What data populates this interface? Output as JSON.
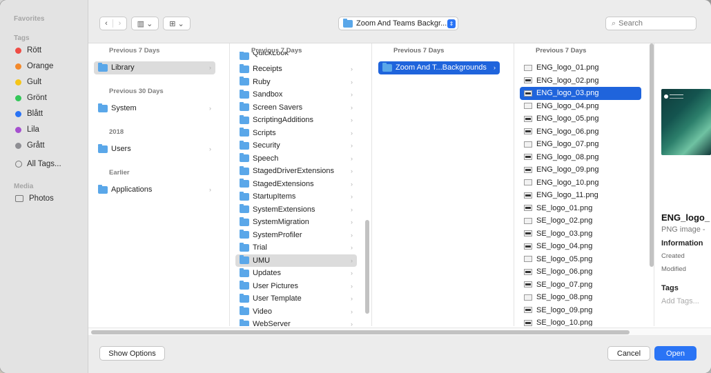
{
  "sidebar": {
    "favorites_header": "Favorites",
    "tags_header": "Tags",
    "tags": [
      {
        "label": "Rött",
        "color": "#ef4c45"
      },
      {
        "label": "Orange",
        "color": "#f3892b"
      },
      {
        "label": "Gult",
        "color": "#f5c518"
      },
      {
        "label": "Grönt",
        "color": "#34c759"
      },
      {
        "label": "Blått",
        "color": "#2a74f5"
      },
      {
        "label": "Lila",
        "color": "#a550cf"
      },
      {
        "label": "Grått",
        "color": "#8e8e93"
      }
    ],
    "all_tags": "All Tags...",
    "media_header": "Media",
    "photos": "Photos"
  },
  "toolbar": {
    "back": "‹",
    "forward": "›",
    "view_columns": "▥ ⌄",
    "group": "⊞ ⌄",
    "path": "Zoom And Teams Backgr...",
    "path_chevron": "⇕",
    "search_placeholder": "Search"
  },
  "column1": {
    "groups": [
      {
        "header": "Previous 7 Days",
        "item": "Library"
      },
      {
        "header": "Previous 30 Days",
        "item": "System"
      },
      {
        "header": "2018",
        "item": "Users"
      },
      {
        "header": "Earlier",
        "item": "Applications"
      }
    ]
  },
  "column2": {
    "header": "Previous 7 Days",
    "partial_top": "QuickLook",
    "items": [
      "Receipts",
      "Ruby",
      "Sandbox",
      "Screen Savers",
      "ScriptingAdditions",
      "Scripts",
      "Security",
      "Speech",
      "StagedDriverExtensions",
      "StagedExtensions",
      "StartupItems",
      "SystemExtensions",
      "SystemMigration",
      "SystemProfiler",
      "Trial",
      "UMU",
      "Updates",
      "User Pictures",
      "User Template",
      "Video",
      "WebServer"
    ],
    "selected": "UMU"
  },
  "column3": {
    "header": "Previous 7 Days",
    "items": [
      "Zoom And T...Backgrounds"
    ]
  },
  "column4": {
    "header": "Previous 7 Days",
    "items": [
      "ENG_logo_01.png",
      "ENG_logo_02.png",
      "ENG_logo_03.png",
      "ENG_logo_04.png",
      "ENG_logo_05.png",
      "ENG_logo_06.png",
      "ENG_logo_07.png",
      "ENG_logo_08.png",
      "ENG_logo_09.png",
      "ENG_logo_10.png",
      "ENG_logo_11.png",
      "SE_logo_01.png",
      "SE_logo_02.png",
      "SE_logo_03.png",
      "SE_logo_04.png",
      "SE_logo_05.png",
      "SE_logo_06.png",
      "SE_logo_07.png",
      "SE_logo_08.png",
      "SE_logo_09.png",
      "SE_logo_10.png"
    ],
    "selected": "ENG_logo_03.png"
  },
  "preview": {
    "filename": "ENG_logo_",
    "kind": "PNG image -",
    "information": "Information",
    "created": "Created",
    "modified": "Modified",
    "tags": "Tags",
    "add_tags": "Add Tags..."
  },
  "footer": {
    "show_options": "Show Options",
    "cancel": "Cancel",
    "open": "Open"
  }
}
